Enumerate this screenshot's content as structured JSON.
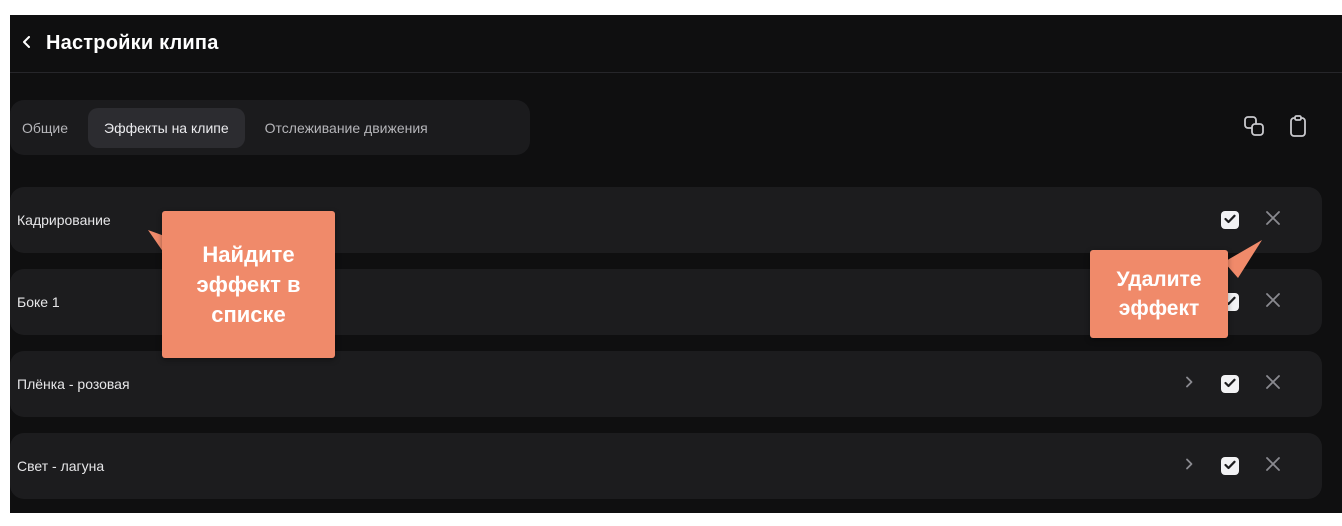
{
  "header": {
    "title": "Настройки клипа",
    "back_icon": "chevron-left-icon"
  },
  "tabs": [
    {
      "label": "Общие",
      "active": false
    },
    {
      "label": "Эффекты на клипе",
      "active": true
    },
    {
      "label": "Отслеживание движения",
      "active": false
    }
  ],
  "toolbar": {
    "copy_icon": "copy-icon",
    "paste_icon": "clipboard-icon"
  },
  "effects": [
    {
      "name": "Кадрирование",
      "expandable": false,
      "enabled": true
    },
    {
      "name": "Боке 1",
      "expandable": false,
      "enabled": true
    },
    {
      "name": "Плёнка - розовая",
      "expandable": true,
      "enabled": true
    },
    {
      "name": "Свет - лагуна",
      "expandable": true,
      "enabled": true
    }
  ],
  "callouts": {
    "find": "Найдите эффект в списке",
    "delete": "Удалите эффект"
  },
  "colors": {
    "panel_bg": "#0f0f10",
    "row_bg": "#1c1c1e",
    "tab_active_bg": "#2c2c30",
    "callout_bg": "#f08a6a",
    "text": "#e6e6e8"
  }
}
